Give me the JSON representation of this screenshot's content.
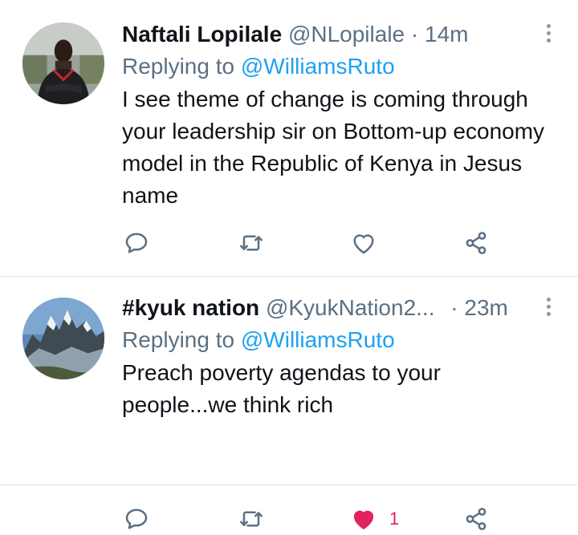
{
  "colors": {
    "accent": "#1da1f2",
    "secondary_text": "#5b7083",
    "like_active": "#e0245e"
  },
  "tweets": [
    {
      "name": "Naftali Lopilale",
      "handle": "@NLopilale",
      "separator": "·",
      "time": "14m",
      "replying_prefix": "Replying to",
      "replying_to": "@WilliamsRuto",
      "text": "I see theme of change is coming through your leadership sir  on Bottom-up economy model in the Republic of Kenya in Jesus name",
      "like_count": "",
      "liked": false,
      "icons": [
        "reply-icon",
        "retweet-icon",
        "like-icon",
        "share-icon",
        "more-options-icon"
      ]
    },
    {
      "name": "#kyuk nation",
      "handle": "@KyukNation2...",
      "separator": "·",
      "time": "23m",
      "replying_prefix": "Replying to",
      "replying_to": "@WilliamsRuto",
      "text": "Preach poverty agendas to your people...we think rich",
      "like_count": "1",
      "liked": true,
      "icons": [
        "reply-icon",
        "retweet-icon",
        "like-icon",
        "share-icon",
        "more-options-icon"
      ]
    }
  ]
}
